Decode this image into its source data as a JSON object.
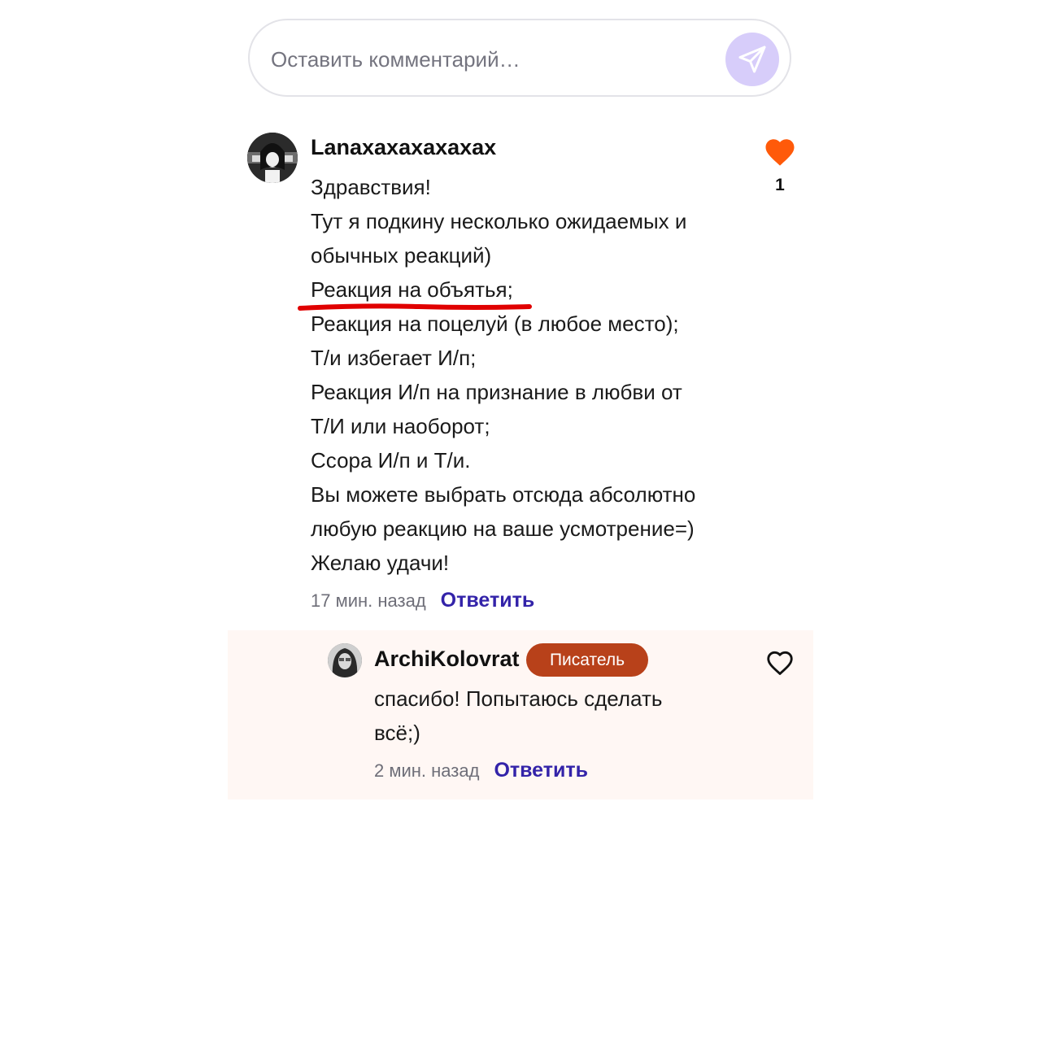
{
  "composer": {
    "placeholder": "Оставить комментарий…",
    "send_icon": "send-arrow-icon",
    "send_bg": "#d7cdfa"
  },
  "comments": [
    {
      "author": "Lanaxaxaxaxaxax",
      "lines": [
        "Здравствия!",
        "Тут я подкину несколько ожидаемых и",
        "обычных реакций)",
        "Реакция на объятья;",
        "Реакция на поцелуй (в любое место);",
        "Т/и избегает И/п;",
        "Реакция И/п на признание в любви от",
        "Т/И или наоборот;",
        "Ссора И/п и Т/и.",
        "Вы можете выбрать отсюда абсолютно",
        "любую реакцию на ваше усмотрение=)",
        "Желаю удачи!"
      ],
      "time": "17 мин. назад",
      "reply_label": "Ответить",
      "likes": "1",
      "liked": true,
      "like_color": "#ff5a0a"
    }
  ],
  "reply": {
    "author": "ArchiKolovrat",
    "badge": "Писатель",
    "badge_color": "#b8411a",
    "lines": [
      "спасибо! Попытаюсь сделать",
      "всё;)"
    ],
    "time": "2 мин. назад",
    "reply_label": "Ответить",
    "liked": false
  },
  "colors": {
    "link": "#3323a9",
    "underline_annotation": "#e00000",
    "reply_bg": "#fff7f4"
  }
}
